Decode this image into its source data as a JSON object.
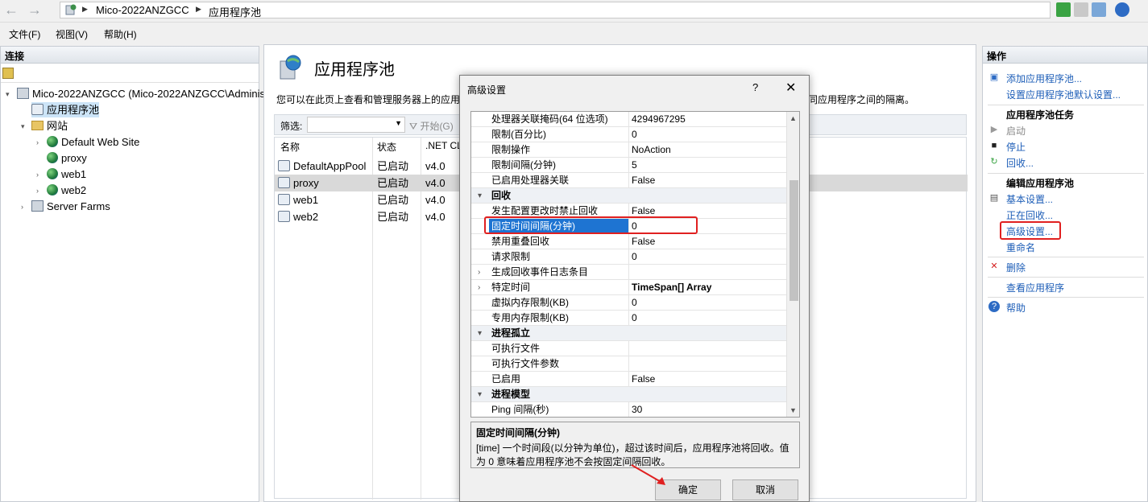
{
  "addressbar": {
    "crumbs": [
      "Mico-2022ANZGCC",
      "应用程序池"
    ]
  },
  "menu": [
    "文件(F)",
    "视图(V)",
    "帮助(H)"
  ],
  "left": {
    "header": "连接",
    "tree": [
      {
        "label": "Mico-2022ANZGCC (Mico-2022ANZGCC\\Adminis",
        "icon": "server-icon"
      },
      {
        "label": "应用程序池",
        "icon": "app-pool-icon",
        "selected": true
      },
      {
        "label": "网站",
        "icon": "folder-icon"
      },
      {
        "label": "Default Web Site",
        "icon": "globe-icon"
      },
      {
        "label": "proxy",
        "icon": "globe-icon"
      },
      {
        "label": "web1",
        "icon": "globe-icon"
      },
      {
        "label": "web2",
        "icon": "globe-icon"
      },
      {
        "label": "Server Farms",
        "icon": "server-farm-icon"
      }
    ]
  },
  "center": {
    "title": "应用程序池",
    "desc_left": "您可以在此页上查看和管理服务器上的应用",
    "desc_right": "同应用程序之间的隔离。",
    "filter_label": "筛选:",
    "start_label": "开始(G)",
    "columns": [
      "名称",
      "状态",
      ".NET CL"
    ],
    "rows": [
      {
        "name": "DefaultAppPool",
        "status": "已启动",
        "clr": "v4.0"
      },
      {
        "name": "proxy",
        "status": "已启动",
        "clr": "v4.0"
      },
      {
        "name": "web1",
        "status": "已启动",
        "clr": "v4.0"
      },
      {
        "name": "web2",
        "status": "已启动",
        "clr": "v4.0"
      }
    ]
  },
  "right": {
    "header": "操作",
    "add_pool": "添加应用程序池...",
    "set_defaults": "设置应用程序池默认设置...",
    "tasks_header": "应用程序池任务",
    "start": "启动",
    "stop": "停止",
    "recycle": "回收...",
    "edit_header": "编辑应用程序池",
    "basic": "基本设置...",
    "recycling": "正在回收...",
    "advanced": "高级设置...",
    "rename": "重命名",
    "delete": "删除",
    "view_apps": "查看应用程序",
    "help": "帮助"
  },
  "dialog": {
    "title": "高级设置",
    "help": "?",
    "close": "✕",
    "rows": [
      {
        "k": "处理器关联掩码(64 位选项)",
        "v": "4294967295"
      },
      {
        "k": "限制(百分比)",
        "v": "0"
      },
      {
        "k": "限制操作",
        "v": "NoAction"
      },
      {
        "k": "限制间隔(分钟)",
        "v": "5"
      },
      {
        "k": "已启用处理器关联",
        "v": "False"
      },
      {
        "k": "回收",
        "v": "",
        "cat": true
      },
      {
        "k": "发生配置更改时禁止回收",
        "v": "False"
      },
      {
        "k": "固定时间间隔(分钟)",
        "v": "0",
        "selected": true
      },
      {
        "k": "禁用重叠回收",
        "v": "False"
      },
      {
        "k": "请求限制",
        "v": "0"
      },
      {
        "k": "生成回收事件日志条目",
        "v": "",
        "expand": true
      },
      {
        "k": "特定时间",
        "v": "TimeSpan[] Array",
        "expand": true,
        "bold_value": true
      },
      {
        "k": "虚拟内存限制(KB)",
        "v": "0"
      },
      {
        "k": "专用内存限制(KB)",
        "v": "0"
      },
      {
        "k": "进程孤立",
        "v": "",
        "cat": true
      },
      {
        "k": "可执行文件",
        "v": ""
      },
      {
        "k": "可执行文件参数",
        "v": ""
      },
      {
        "k": "已启用",
        "v": "False"
      },
      {
        "k": "进程模型",
        "v": "",
        "cat": true
      },
      {
        "k": "Ping 间隔(秒)",
        "v": "30"
      }
    ],
    "desc_title": "固定时间间隔(分钟)",
    "desc_line1": "[time] 一个时间段(以分钟为单位)，超过该时间后，应用程序池将回收。值",
    "desc_line2": "为 0 意味着应用程序池不会按固定间隔回收。",
    "ok": "确定",
    "cancel": "取消"
  }
}
